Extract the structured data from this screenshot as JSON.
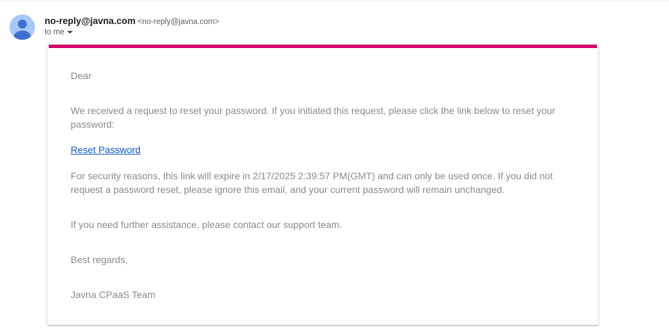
{
  "header": {
    "avatar_icon": "person-icon",
    "sender_name": "no-reply@javna.com",
    "sender_email": "<no-reply@javna.com>",
    "recipient_label": "to me",
    "recipient_toggle_icon": "caret-down-icon"
  },
  "message": {
    "accent_color": "#d4006a",
    "greeting": "Dear",
    "paragraph_request": "We received a request to reset your password. If you initiated this request, please click the link below to reset your password:",
    "reset_link_label": "Reset Password",
    "paragraph_security": "For security reasons, this link will expire in 2/17/2025 2:39:57 PM(GMT) and can only be used once. If you did not request a password reset, please ignore this email, and your current password will remain unchanged.",
    "paragraph_assistance": "If you need further assistance, please contact our support team.",
    "closing": "Best regards,",
    "signature": "Javna CPaaS Team"
  }
}
